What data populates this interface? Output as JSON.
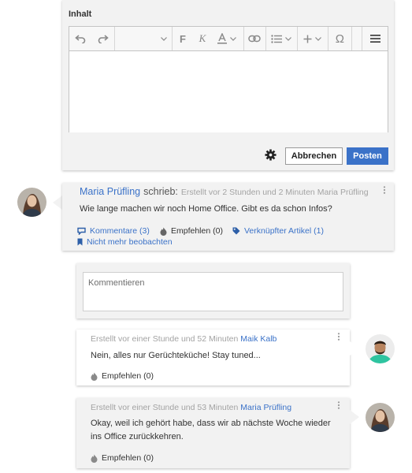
{
  "editor": {
    "label": "Inhalt",
    "cancel_label": "Abbrechen",
    "post_label": "Posten"
  },
  "post": {
    "author": "Maria Prüfling",
    "wrote": "schrieb:",
    "meta": "Erstellt vor 2 Stunden und 2 Minuten",
    "meta_author": "Maria Prüfling",
    "text": "Wie lange machen wir noch Home Office. Gibt es da schon Infos?",
    "comments_label": "Kommentare (3)",
    "recommend_label": "Empfehlen (0)",
    "linked_article_label": "Verknüpfter Artikel (1)",
    "unfollow_label": "Nicht mehr beobachten"
  },
  "comment_input": {
    "placeholder": "Kommentieren"
  },
  "replies": [
    {
      "meta": "Erstellt vor einer Stunde und 52 Minuten",
      "author": "Maik Kalb",
      "text": "Nein, alles nur Gerüchteküche! Stay tuned...",
      "recommend_label": "Empfehlen (0)"
    },
    {
      "meta": "Erstellt vor einer Stunde und 53 Minuten",
      "author": "Maria Prüfling",
      "text": "Okay, weil ich gehört habe, dass wir ab nächste Woche wieder ins Office zurückkehren.",
      "recommend_label": "Empfehlen (0)"
    }
  ],
  "colors": {
    "accent": "#3b72c8",
    "panel": "#f2f2f2"
  }
}
